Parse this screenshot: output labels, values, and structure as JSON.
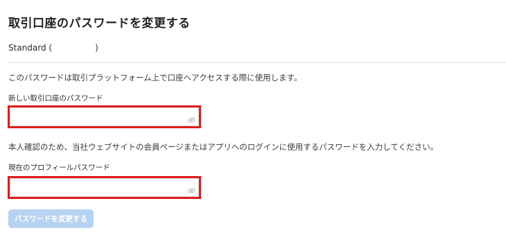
{
  "page": {
    "title": "取引口座のパスワードを変更する"
  },
  "account": {
    "type": "Standard",
    "open_paren": "(",
    "close_paren": ")"
  },
  "trading_password": {
    "description": "このパスワードは取引プラットフォーム上で口座へアクセスする際に使用します。",
    "label": "新しい取引口座のパスワード",
    "value": "",
    "toggle_icon": "eye-slash-icon"
  },
  "profile_password": {
    "description": "本人確認のため、当社ウェブサイトの会員ページまたはアプリへのログインに使用するパスワードを入力してください。",
    "label": "現在のプロフィールパスワード",
    "value": "",
    "toggle_icon": "eye-slash-icon"
  },
  "submit": {
    "label": "パスワードを変更する",
    "enabled": false
  },
  "colors": {
    "highlight_border": "#e01b1b",
    "button_disabled_bg": "#b7d3f3",
    "button_text": "#ffffff",
    "divider": "#e3e3e3"
  }
}
